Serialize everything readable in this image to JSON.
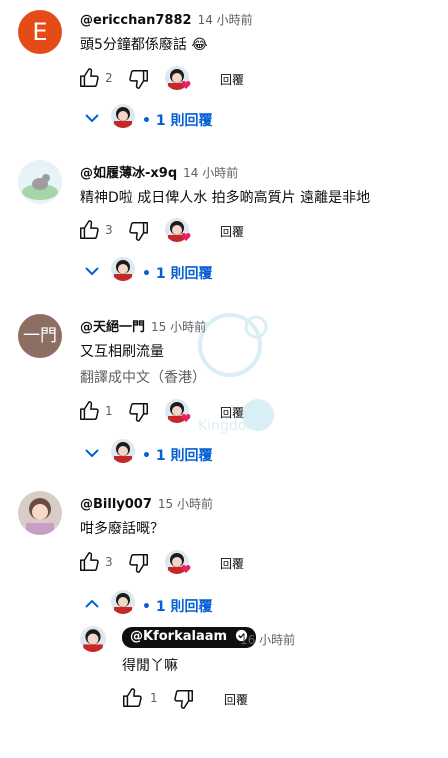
{
  "reply_label": "回覆",
  "comments": [
    {
      "handle": "@ericchan7882",
      "time": "14 小時前",
      "text": "頭5分鐘都係廢話 😂",
      "likes": "2",
      "replies": "1 則回覆",
      "avatar_letter": "E",
      "avatar_color": "#e64a19"
    },
    {
      "handle": "@如履薄冰-x9q",
      "time": "14 小時前",
      "text": "精神D啦 成日俾人水  拍多啲高質片 遠離是非地",
      "likes": "3",
      "replies": "1 則回覆"
    },
    {
      "handle": "@天絕一門",
      "time": "15 小時前",
      "text": "又互相刷流量",
      "translate": "翻譯成中文（香港）",
      "likes": "1",
      "replies": "1 則回覆",
      "avatar_letter": "一門",
      "avatar_color": "#8d6e63"
    },
    {
      "handle": "@Billy007",
      "time": "15 小時前",
      "text": "咁多廢話嘅？",
      "likes": "3",
      "replies": "1 則回覆"
    }
  ],
  "reply": {
    "handle": "@Kforkalaam",
    "time": "16 小時前",
    "text": "得閒丫嘛",
    "likes": "1"
  },
  "colors": {
    "accent": "#065fd4",
    "text": "#0f0f0f",
    "secondary": "#606060",
    "heart": "#e91e63"
  }
}
